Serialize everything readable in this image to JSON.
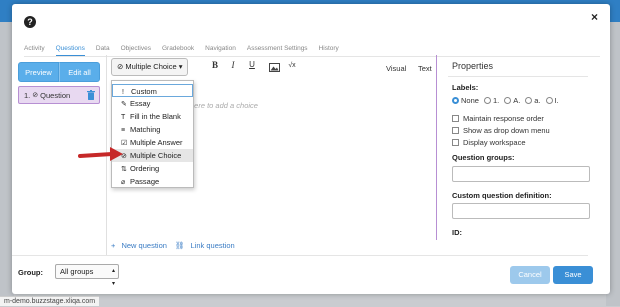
{
  "modal": {
    "help_icon": "?",
    "close_icon": "×"
  },
  "tabs": [
    "Activity",
    "Questions",
    "Data",
    "Objectives",
    "Gradebook",
    "Navigation",
    "Assessment Settings",
    "History"
  ],
  "left_panel": {
    "preview_label": "Preview",
    "edit_all_label": "Edit all",
    "question_item": "1. ",
    "question_label": "Question"
  },
  "editor": {
    "type_dropdown_label": "Multiple Choice",
    "type_dropdown_caret": "▾",
    "toolbar": {
      "bold": "B",
      "italic": "I",
      "underline": "U",
      "image": "image-icon",
      "sqrt": "√x"
    },
    "visual_tab": "Visual",
    "text_tab": "Text",
    "hint": "here to add a choice",
    "add_question": "New question",
    "link_question": "Link question"
  },
  "type_menu": [
    {
      "icon": "!",
      "label": "Custom"
    },
    {
      "icon": "✎",
      "label": "Essay"
    },
    {
      "icon": "T",
      "label": "Fill in the Blank"
    },
    {
      "icon": "≡",
      "label": "Matching"
    },
    {
      "icon": "☑",
      "label": "Multiple Answer"
    },
    {
      "icon": "⊘",
      "label": "Multiple Choice"
    },
    {
      "icon": "⇅",
      "label": "Ordering"
    },
    {
      "icon": "⌀",
      "label": "Passage"
    }
  ],
  "properties": {
    "title": "Properties",
    "labels_heading": "Labels:",
    "label_options": [
      "None",
      "1.",
      "A.",
      "a.",
      "I."
    ],
    "checkboxes": [
      "Maintain response order",
      "Show as drop down menu",
      "Display workspace"
    ],
    "question_groups_heading": "Question groups:",
    "custom_definition_heading": "Custom question definition:",
    "id_heading": "ID:"
  },
  "footer": {
    "group_label": "Group:",
    "group_value": "All groups",
    "cancel_label": "Cancel",
    "save_label": "Save"
  },
  "status_url": "m-demo.buzzstage.xliqa.com",
  "colors": {
    "accent": "#3a8fd6",
    "arrow": "#c62828",
    "question_item": "#e8d9f1"
  }
}
